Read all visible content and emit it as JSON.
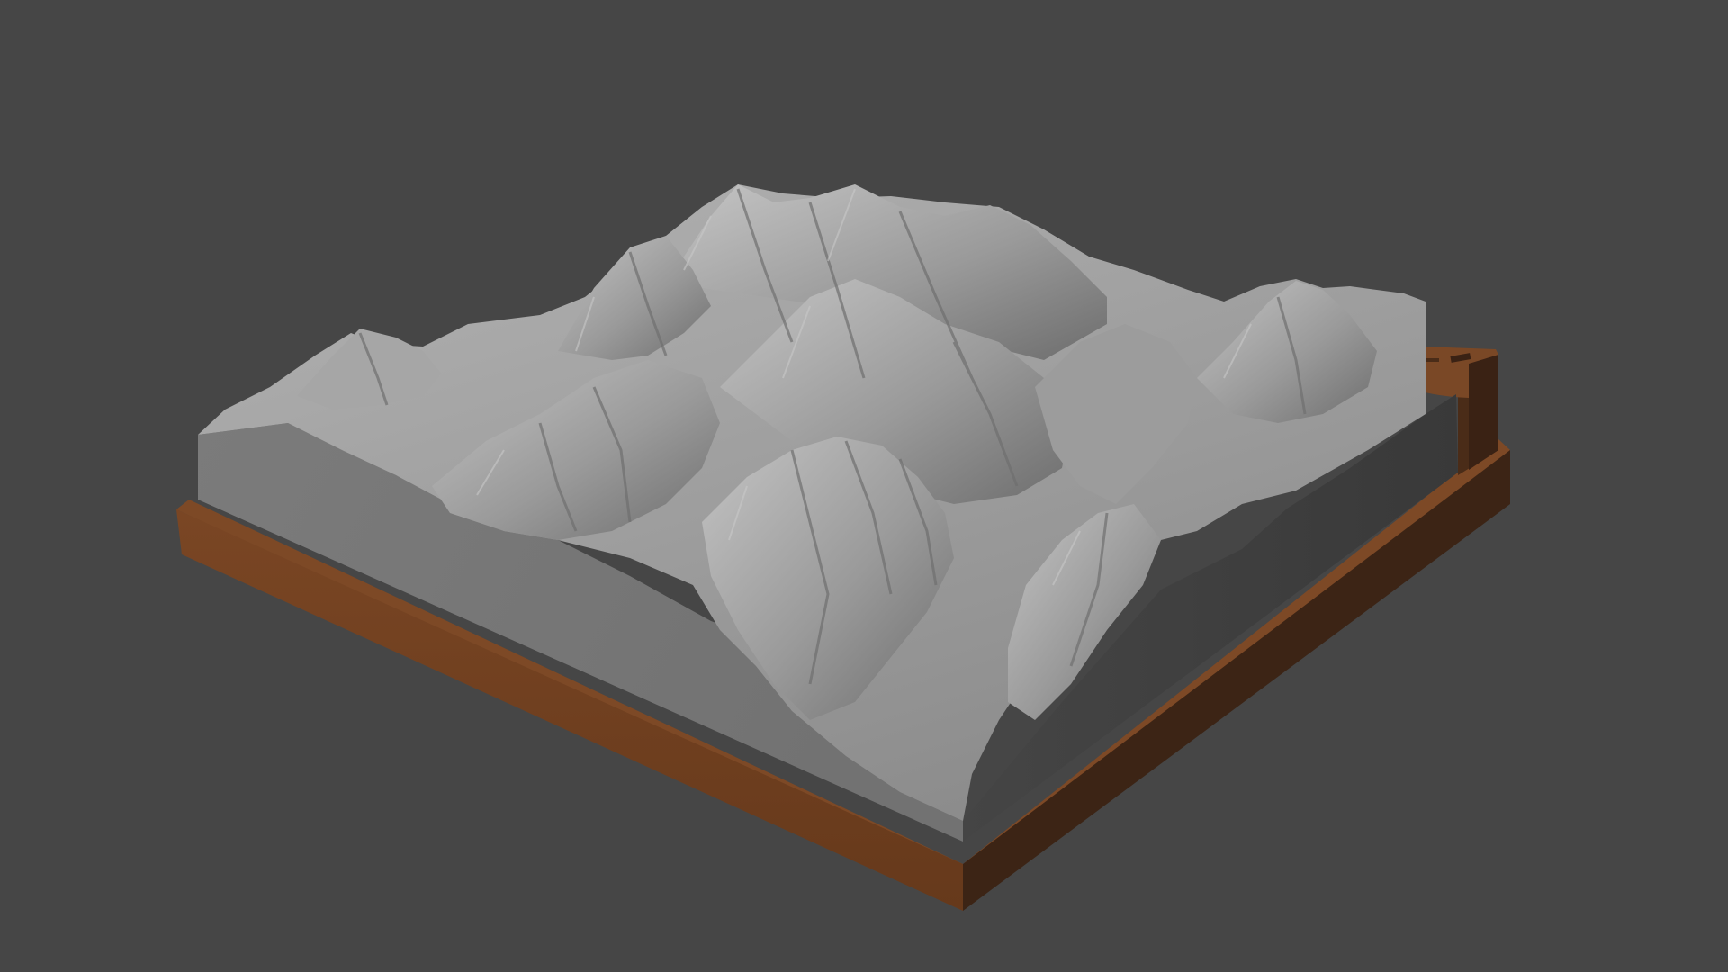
{
  "scene": {
    "background_color": "#464646",
    "terrain_color": "#8f8f8f",
    "terrain_side_light": "#7a7a7a",
    "terrain_side_dark": "#3b3b3b",
    "base_color": "#6e3f1e",
    "base_side_dark": "#3c2415"
  }
}
